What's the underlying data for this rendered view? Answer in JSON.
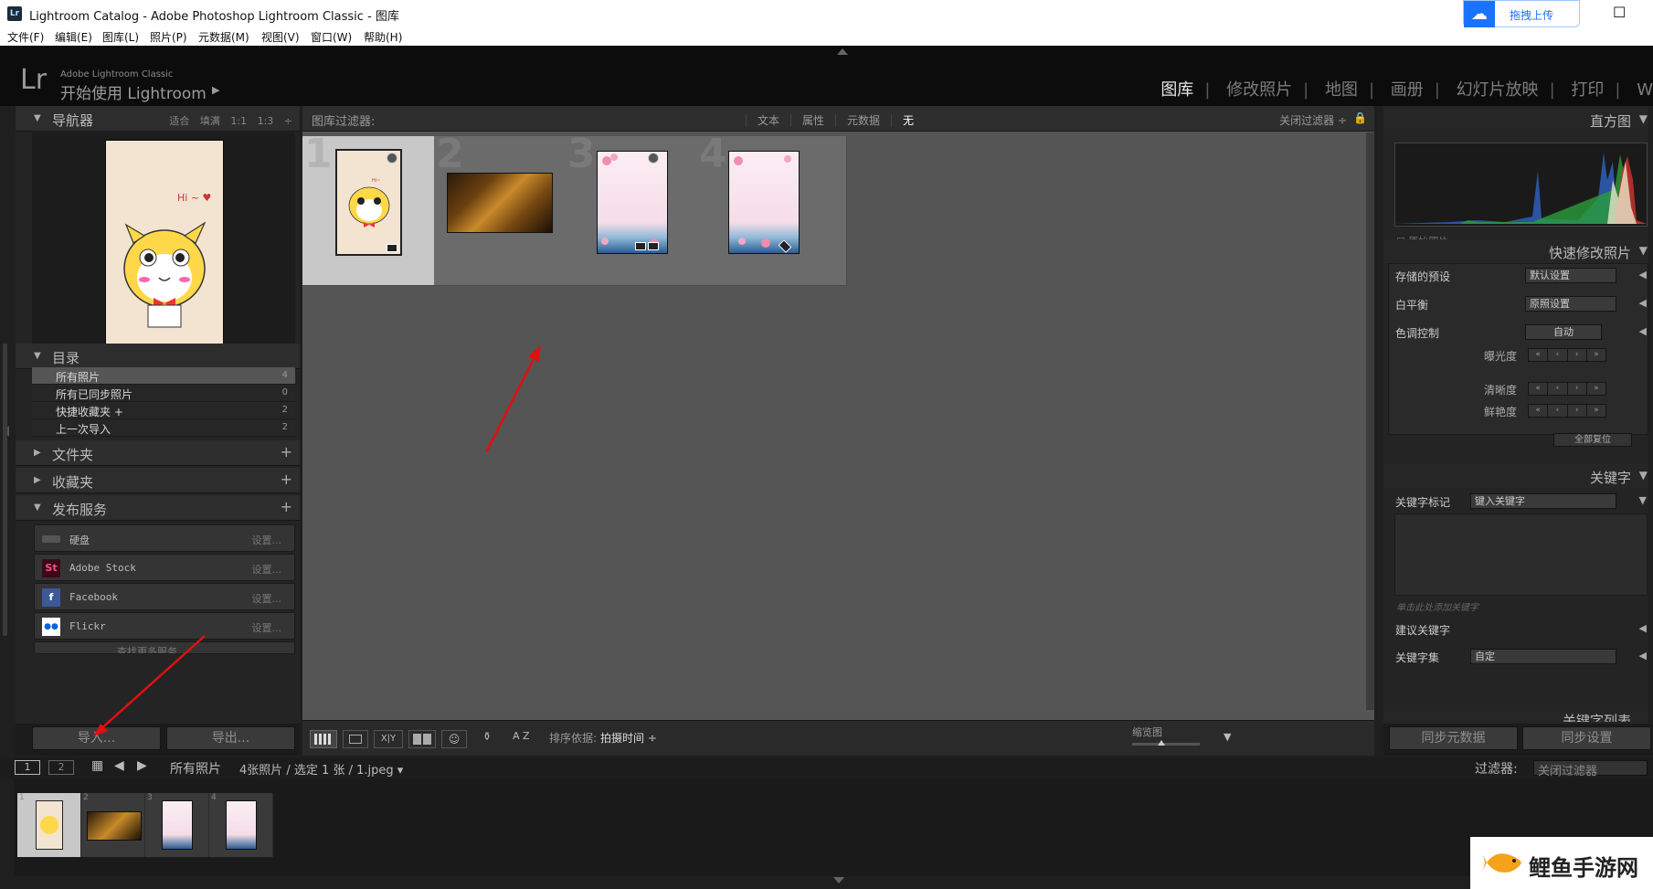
{
  "window": {
    "title": "Lightroom Catalog - Adobe Photoshop Lightroom Classic - 图库",
    "app_icon": "Lr",
    "upload_label": "拖拽上传"
  },
  "menu": [
    "文件(F)",
    "编辑(E)",
    "图库(L)",
    "照片(P)",
    "元数据(M)",
    "视图(V)",
    "窗口(W)",
    "帮助(H)"
  ],
  "identity": {
    "logo": "Lr",
    "brand": "Adobe Lightroom Classic",
    "subtitle": "开始使用 Lightroom",
    "play": "▶"
  },
  "modules": {
    "library": "图库",
    "develop": "修改照片",
    "map": "地图",
    "book": "画册",
    "slideshow": "幻灯片放映",
    "print": "打印",
    "web": "W"
  },
  "navigator": {
    "title": "导航器",
    "opts": "适合 填满 1:1 1:3 ÷"
  },
  "catalog": {
    "title": "目录",
    "items": [
      {
        "label": "所有照片",
        "count": "4"
      },
      {
        "label": "所有已同步照片",
        "count": "0"
      },
      {
        "label": "快捷收藏夹 +",
        "count": "2"
      },
      {
        "label": "上一次导入",
        "count": "2"
      }
    ]
  },
  "folders": {
    "title": "文件夹"
  },
  "collections": {
    "title": "收藏夹"
  },
  "publish": {
    "title": "发布服务",
    "items": [
      {
        "icon": "▭",
        "name": "硬盘",
        "setup": "设置..."
      },
      {
        "icon": "St",
        "name": "Adobe Stock",
        "setup": "设置..."
      },
      {
        "icon": "f",
        "name": "Facebook",
        "setup": "设置..."
      },
      {
        "icon": "●●",
        "name": "Flickr",
        "setup": "设置..."
      }
    ],
    "more": "查找更多服务"
  },
  "buttons": {
    "import": "导入...",
    "export": "导出...",
    "sync_meta": "同步元数据",
    "sync_settings": "同步设置"
  },
  "filter": {
    "label": "图库过滤器:",
    "options": [
      "文本",
      "属性",
      "元数据",
      "无"
    ],
    "active": "无",
    "close": "关闭过滤器 ÷"
  },
  "grid": [
    {
      "num": "1"
    },
    {
      "num": "2"
    },
    {
      "num": "3"
    },
    {
      "num": "4"
    }
  ],
  "toolbar": {
    "sort_label": "排序依据:",
    "sort_value": "拍摄时间 ÷",
    "zoom_label": "缩览图",
    "az": "A Z",
    "xy": "X|Y"
  },
  "histogram": {
    "title": "直方图",
    "original": "原始照片"
  },
  "quick": {
    "title": "快速修改照片",
    "preset_label": "存储的预设",
    "preset_value": "默认设置",
    "wb_label": "白平衡",
    "wb_value": "原照设置",
    "tone_label": "色调控制",
    "auto": "自动",
    "exposure": "曝光度",
    "clarity": "清晰度",
    "vibrance": "鲜艳度",
    "reset": "全部复位"
  },
  "keywords": {
    "title": "关键字",
    "tag_label": "关键字标记",
    "tag_value": "键入关键字",
    "hint": "单击此处添加关键字",
    "suggest": "建议关键字",
    "set_label": "关键字集",
    "set_value": "自定",
    "list": "关键字列表"
  },
  "filmbar": {
    "p1": "1",
    "p2": "2",
    "source": "所有照片",
    "info": "4张照片 / 选定 1 张 / 1.jpeg ▾",
    "filter_label": "过滤器:",
    "filter_value": "关闭过滤器"
  },
  "film": [
    "1",
    "2",
    "3",
    "4"
  ],
  "watermark": {
    "text": "鲤鱼手游网"
  }
}
